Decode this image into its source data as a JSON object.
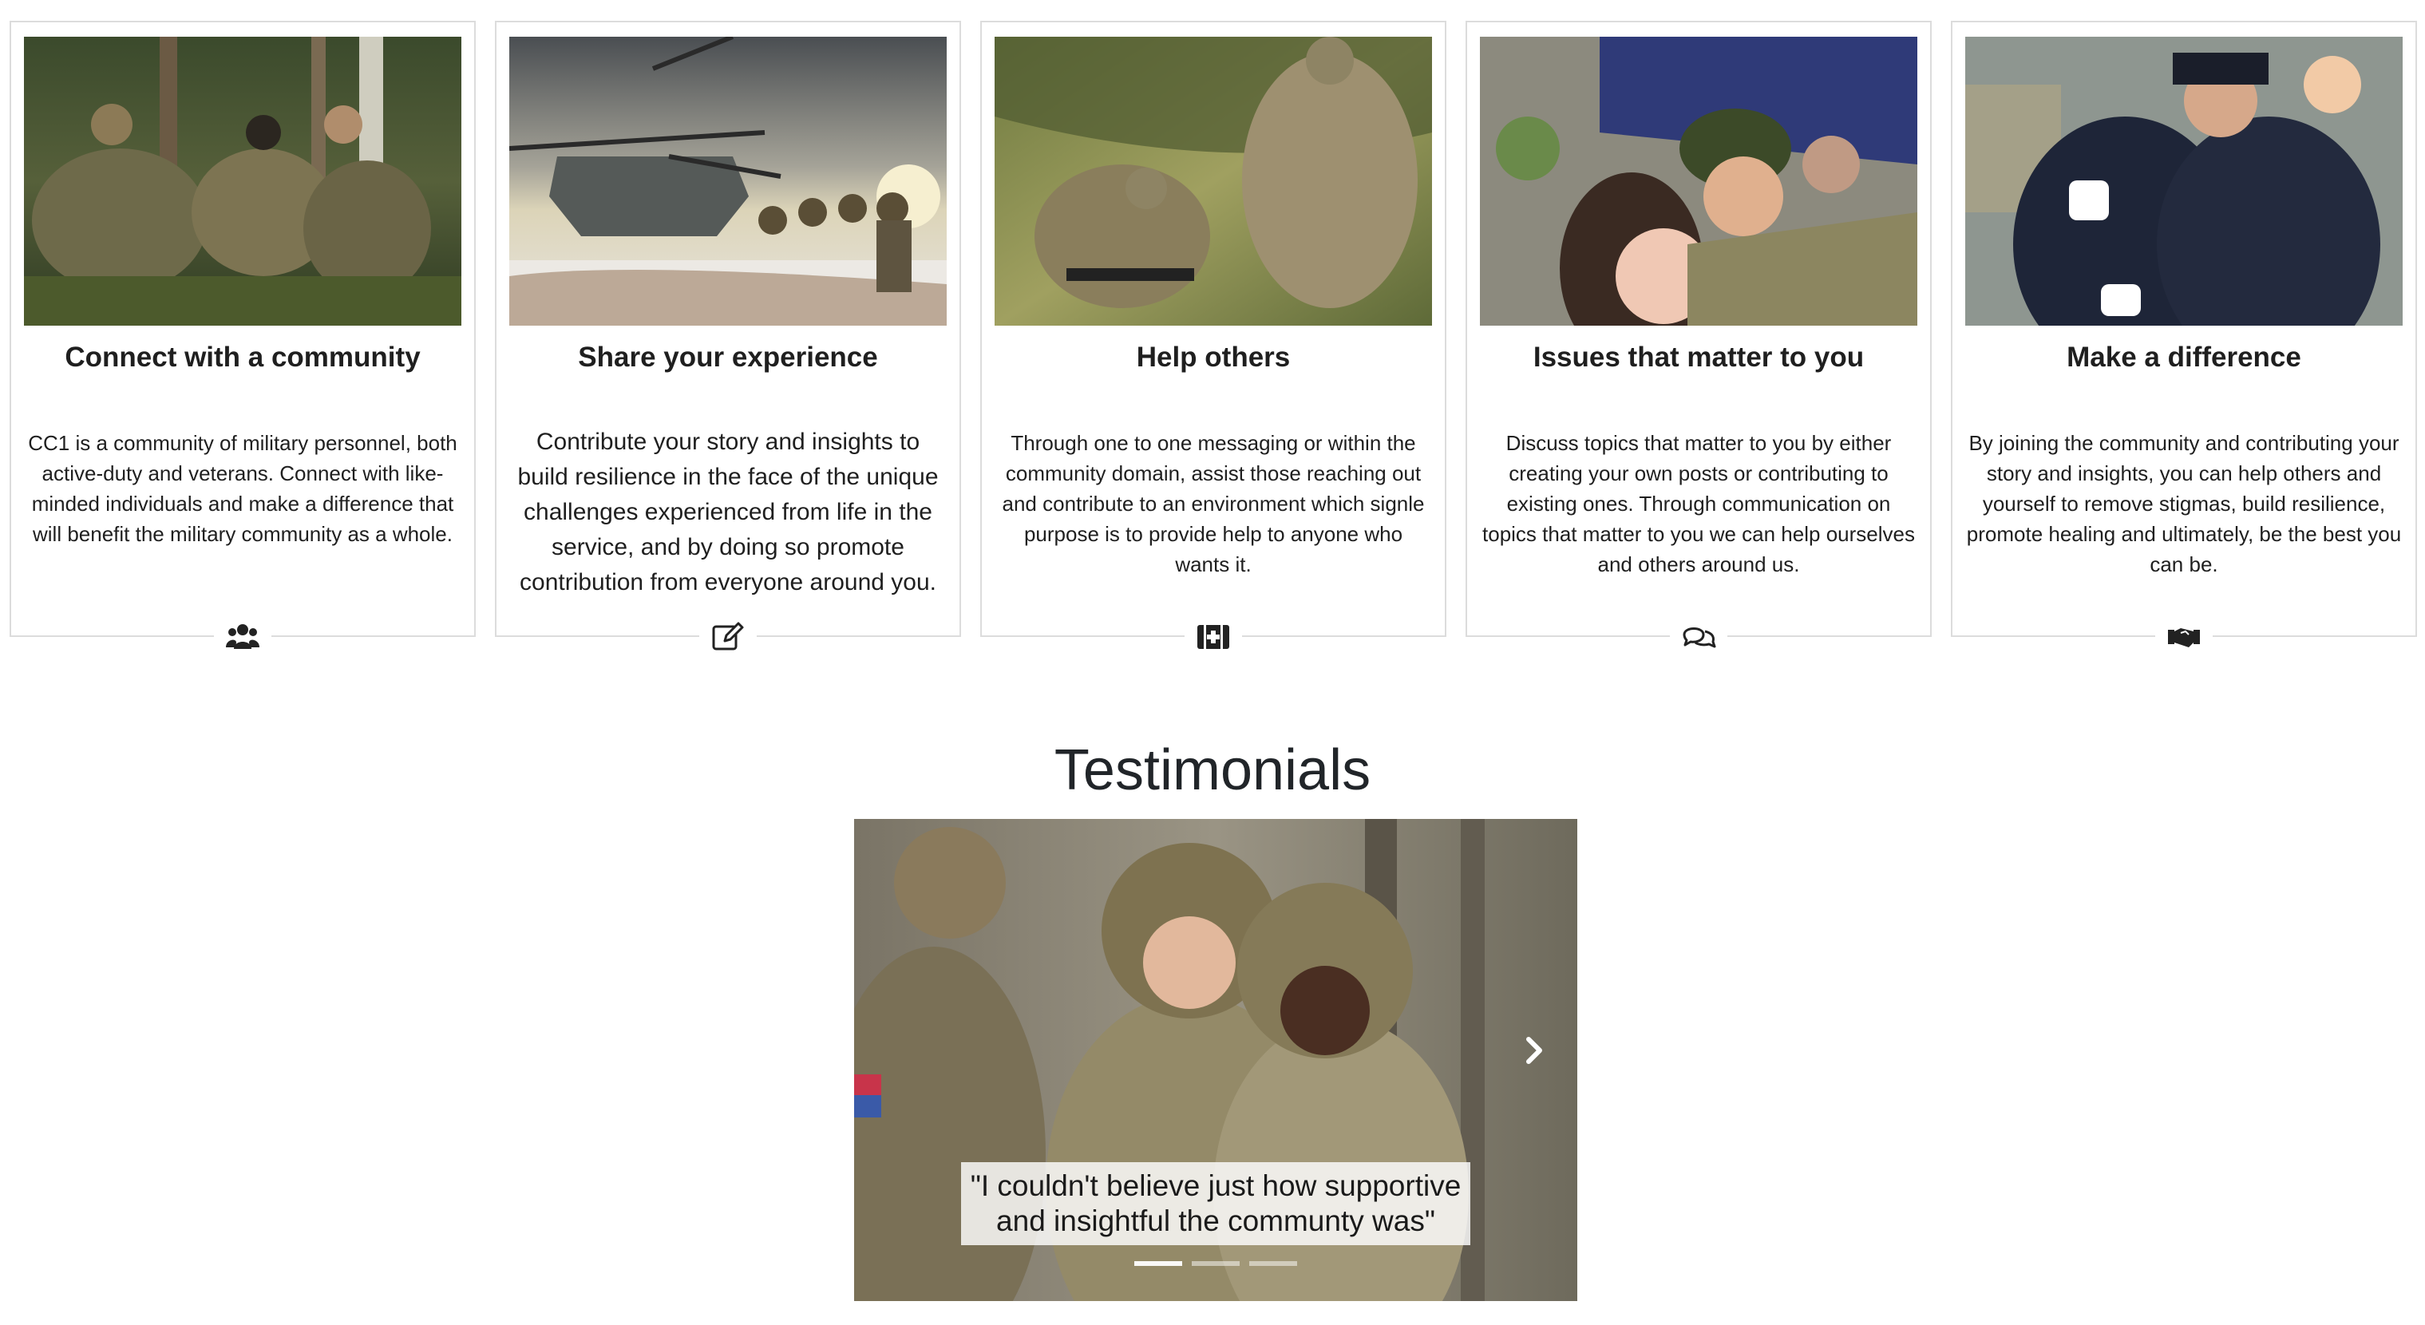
{
  "features": [
    {
      "title": "Connect with a community",
      "body": "CC1 is a community of military personnel, both active-duty and veterans. Connect with like-minded individuals and make a difference that will benefit the military community as a whole.",
      "icon": "users-icon",
      "image": "soldiers-resting-in-forest-photo"
    },
    {
      "title": "Share your experience",
      "body": "Contribute your story and insights to build resilience in the face of the unique challenges experienced from life in the service, and by doing so promote contribution from everyone around you.",
      "icon": "edit-icon",
      "image": "helicopter-troops-snow-photo"
    },
    {
      "title": "Help others",
      "body": "Through one to one messaging or within the community domain, assist those reaching out and contribute to an environment which signle purpose is to provide help to anyone who wants it.",
      "icon": "medkit-icon",
      "image": "soldier-helping-hand-photo"
    },
    {
      "title": "Issues that matter to you",
      "body": "Discuss topics that matter to you by either creating your own posts or contributing to existing ones. Through communication on topics that matter to you we can help ourselves and others around us.",
      "icon": "comments-icon",
      "image": "soldier-family-reunion-photo"
    },
    {
      "title": "Make a difference",
      "body": "By joining the community and contributing your story and insights, you can help others and yourself to remove stigmas, build resilience, promote healing and ultimately, be the best you can be.",
      "icon": "handshake-icon",
      "image": "officer-embrace-photo"
    }
  ],
  "testimonials": {
    "heading": "Testimonials",
    "caption": "\"I couldn't believe just how supportive and insightful the communty was\"",
    "slide_count": 3,
    "active_slide": 1,
    "image": "smiling-soldiers-photo"
  }
}
